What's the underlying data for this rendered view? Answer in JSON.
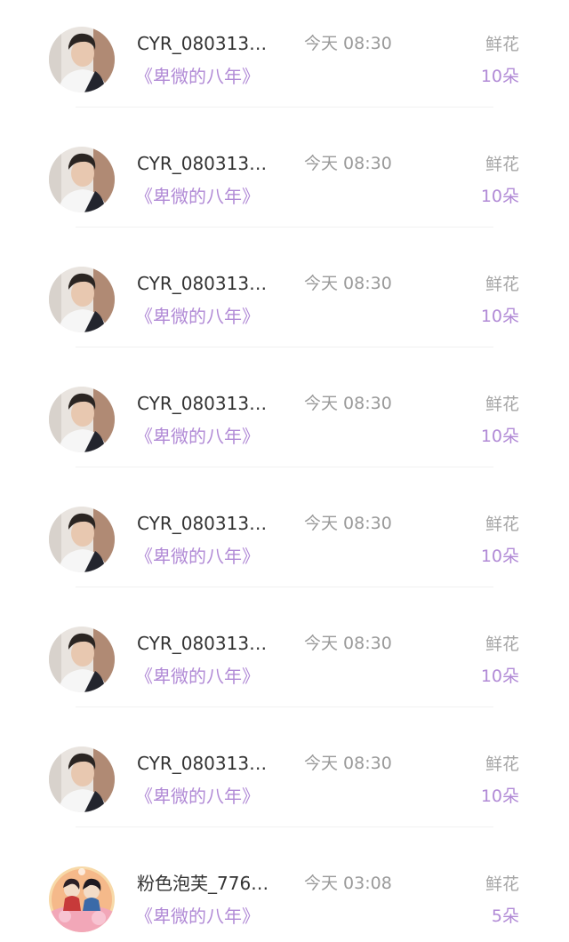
{
  "records": [
    {
      "username": "CYR_080313…",
      "time": "今天 08:30",
      "gift_type": "鲜花",
      "book": "《卑微的八年》",
      "count": "10朵",
      "avatar_icon": "avatar-man-photo"
    },
    {
      "username": "CYR_080313…",
      "time": "今天 08:30",
      "gift_type": "鲜花",
      "book": "《卑微的八年》",
      "count": "10朵",
      "avatar_icon": "avatar-man-photo"
    },
    {
      "username": "CYR_080313…",
      "time": "今天 08:30",
      "gift_type": "鲜花",
      "book": "《卑微的八年》",
      "count": "10朵",
      "avatar_icon": "avatar-man-photo"
    },
    {
      "username": "CYR_080313…",
      "time": "今天 08:30",
      "gift_type": "鲜花",
      "book": "《卑微的八年》",
      "count": "10朵",
      "avatar_icon": "avatar-man-photo"
    },
    {
      "username": "CYR_080313…",
      "time": "今天 08:30",
      "gift_type": "鲜花",
      "book": "《卑微的八年》",
      "count": "10朵",
      "avatar_icon": "avatar-man-photo"
    },
    {
      "username": "CYR_080313…",
      "time": "今天 08:30",
      "gift_type": "鲜花",
      "book": "《卑微的八年》",
      "count": "10朵",
      "avatar_icon": "avatar-man-photo"
    },
    {
      "username": "CYR_080313…",
      "time": "今天 08:30",
      "gift_type": "鲜花",
      "book": "《卑微的八年》",
      "count": "10朵",
      "avatar_icon": "avatar-man-photo"
    },
    {
      "username": "粉色泡芙_776…",
      "time": "今天 03:08",
      "gift_type": "鲜花",
      "book": "《卑微的八年》",
      "count": "5朵",
      "avatar_icon": "avatar-cartoon-couple"
    }
  ],
  "colors": {
    "accent_purple": "#b18ad6",
    "name_text": "#333333",
    "muted_text": "#9a9a9a",
    "divider": "#f1f1f1"
  }
}
